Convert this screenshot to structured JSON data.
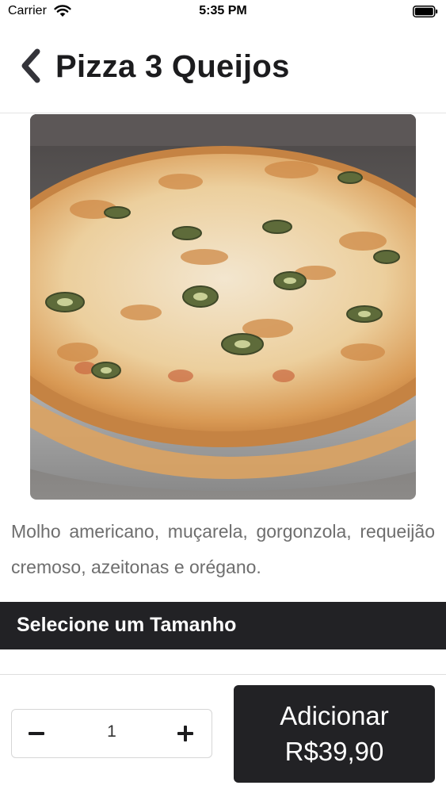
{
  "status_bar": {
    "carrier": "Carrier",
    "time": "5:35 PM",
    "wifi_icon": "wifi-icon",
    "battery_icon": "battery-icon"
  },
  "nav": {
    "back_icon": "chevron-left-icon",
    "title": "Pizza 3 Queijos"
  },
  "product": {
    "image": "pizza-photo",
    "description": "Molho americano, muçarela, gorgonzola, requeijão cremoso, azeitonas e orégano."
  },
  "size_section": {
    "title": "Selecione um Tamanho"
  },
  "footer": {
    "quantity": "1",
    "minus_icon": "minus-icon",
    "plus_icon": "plus-icon",
    "add_label": "Adicionar",
    "add_price": "R$39,90"
  },
  "colors": {
    "dark": "#222225",
    "text_secondary": "#6e6e6e"
  }
}
